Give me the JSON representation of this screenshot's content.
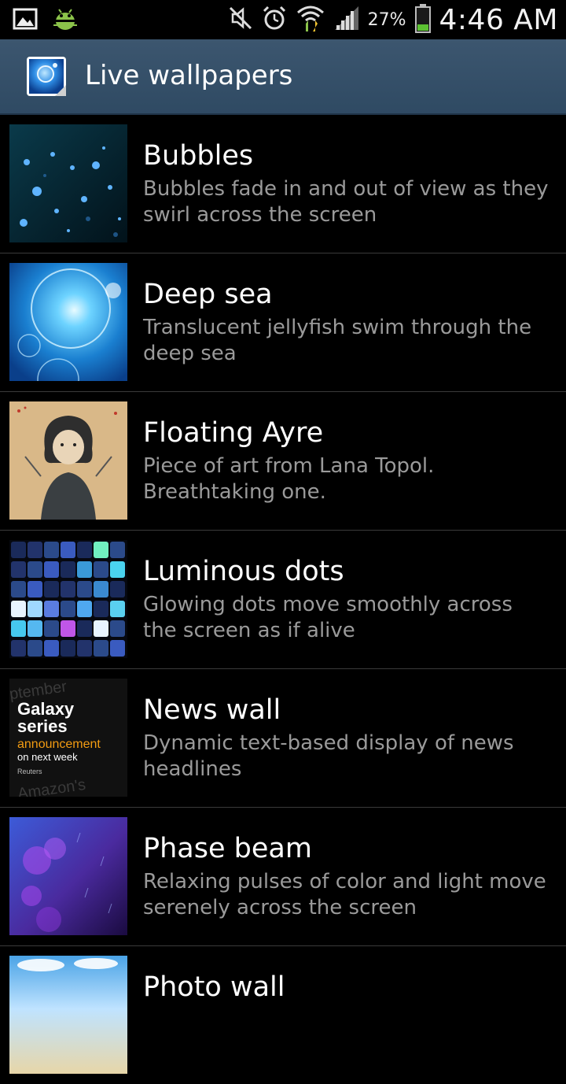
{
  "status_bar": {
    "icons_left": [
      "gallery-icon",
      "android-debug-icon"
    ],
    "icons_right": [
      "mute-icon",
      "alarm-icon",
      "wifi-icon",
      "signal-icon",
      "battery-icon"
    ],
    "battery_percent": "27%",
    "time": "4:46 AM"
  },
  "app_bar": {
    "title": "Live wallpapers",
    "icon": "live-wallpaper-app-icon"
  },
  "wallpapers": [
    {
      "name": "Bubbles",
      "description": "Bubbles fade in and out of view as they swirl across the screen",
      "thumbnail": "bubbles-thumbnail"
    },
    {
      "name": "Deep sea",
      "description": "Translucent jellyfish swim through the deep sea",
      "thumbnail": "deep-sea-thumbnail"
    },
    {
      "name": "Floating Ayre",
      "description": "Piece of art from Lana Topol. Breathtaking one.",
      "thumbnail": "floating-ayre-thumbnail"
    },
    {
      "name": "Luminous dots",
      "description": "Glowing dots move smoothly across the screen as if alive",
      "thumbnail": "luminous-dots-thumbnail"
    },
    {
      "name": "News wall",
      "description": "Dynamic text-based display of news headlines",
      "thumbnail": "news-wall-thumbnail",
      "thumbnail_text": {
        "line1": "Galaxy",
        "line2": "series",
        "line3": "announcement",
        "line4": "on next week",
        "source": "Reuters",
        "bg_top": "ptember",
        "bg_bottom": "Amazon's"
      }
    },
    {
      "name": "Phase beam",
      "description": "Relaxing pulses of color and light move serenely across the screen",
      "thumbnail": "phase-beam-thumbnail"
    },
    {
      "name": "Photo wall",
      "description": "",
      "thumbnail": "photo-wall-thumbnail"
    }
  ]
}
